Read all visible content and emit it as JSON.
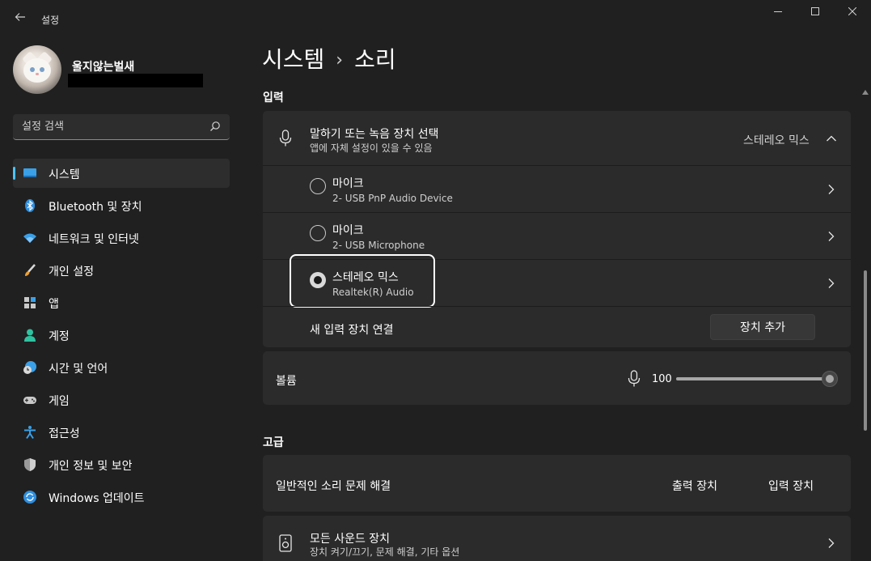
{
  "window": {
    "title": "설정"
  },
  "profile": {
    "name": "울지않는벌새"
  },
  "search": {
    "placeholder": "설정 검색"
  },
  "sidebar": {
    "items": [
      {
        "label": "시스템",
        "icon": "monitor-icon",
        "active": true
      },
      {
        "label": "Bluetooth 및 장치",
        "icon": "bluetooth-icon"
      },
      {
        "label": "네트워크 및 인터넷",
        "icon": "wifi-icon"
      },
      {
        "label": "개인 설정",
        "icon": "brush-icon"
      },
      {
        "label": "앱",
        "icon": "apps-icon"
      },
      {
        "label": "계정",
        "icon": "person-icon"
      },
      {
        "label": "시간 및 언어",
        "icon": "clock-globe-icon"
      },
      {
        "label": "게임",
        "icon": "gamepad-icon"
      },
      {
        "label": "접근성",
        "icon": "accessibility-icon"
      },
      {
        "label": "개인 정보 및 보안",
        "icon": "shield-icon"
      },
      {
        "label": "Windows 업데이트",
        "icon": "update-icon"
      }
    ]
  },
  "breadcrumb": {
    "parent": "시스템",
    "separator": "›",
    "current": "소리"
  },
  "input_section": {
    "label": "입력",
    "device_select": {
      "title": "말하기 또는 녹음 장치 선택",
      "subtitle": "앱에 자체 설정이 있을 수 있음",
      "value": "스테레오 믹스"
    },
    "devices": [
      {
        "name": "마이크",
        "detail": "2- USB PnP Audio Device",
        "selected": false
      },
      {
        "name": "마이크",
        "detail": "2- USB Microphone",
        "selected": false
      },
      {
        "name": "스테레오 믹스",
        "detail": "Realtek(R) Audio",
        "selected": true
      }
    ],
    "pair": {
      "label": "새 입력 장치 연결",
      "button": "장치 추가"
    },
    "volume": {
      "label": "볼륨",
      "value": "100"
    }
  },
  "advanced_section": {
    "label": "고급",
    "troubleshoot": {
      "label": "일반적인 소리 문제 해결",
      "output_link": "출력 장치",
      "input_link": "입력 장치"
    },
    "all_devices": {
      "title": "모든 사운드 장치",
      "subtitle": "장치 켜기/끄기, 문제 해결, 기타 옵션"
    }
  },
  "colors": {
    "background": "#202020",
    "card": "#2b2b2b",
    "accent": "#4cc2ff"
  }
}
